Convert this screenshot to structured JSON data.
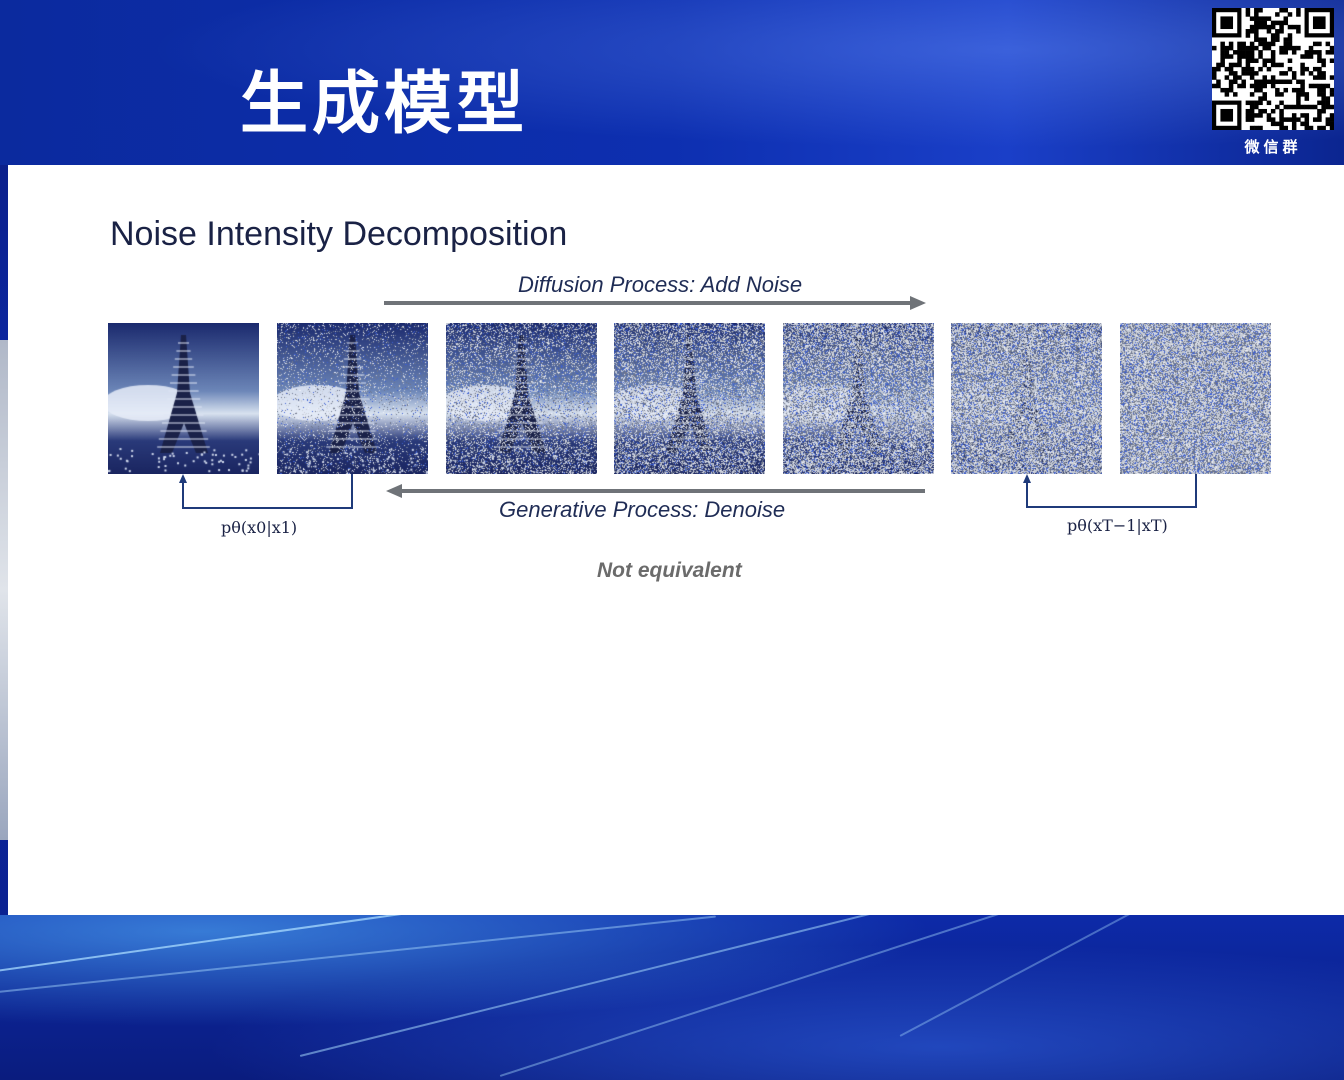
{
  "header": {
    "title": "生成模型",
    "qr_label": "微信群"
  },
  "slide": {
    "title": "Noise Intensity Decomposition",
    "diffusion_label": "Diffusion Process: Add Noise",
    "generative_label": "Generative Process: Denoise",
    "formula_left": "pθ(x0|x1)",
    "formula_right": "pθ(xT−1|xT)",
    "note": "Not equivalent",
    "noise_levels": [
      0.0,
      0.15,
      0.35,
      0.55,
      0.75,
      0.92,
      1.0
    ]
  },
  "colors": {
    "arrow": "#6f7378",
    "bracket": "#1f3a7a",
    "tile_dark": "#1b2a6e",
    "noise_blue": "#3a5fd0"
  }
}
